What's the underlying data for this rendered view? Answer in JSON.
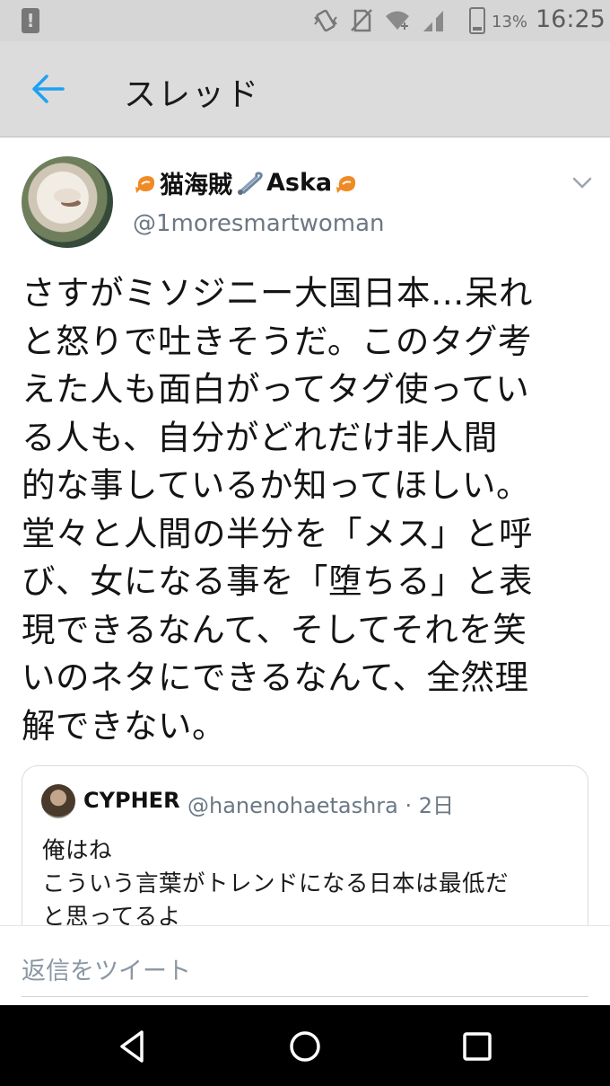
{
  "status_bar": {
    "battery_percent": "13%",
    "time": "16:25",
    "alert_symbol": "!"
  },
  "app_bar": {
    "title": "スレッド",
    "back_icon": "arrow-left-icon"
  },
  "tweet": {
    "display_name": "猫海賊",
    "display_name_suffix": "Aska",
    "handle": "@1moresmartwoman",
    "text": "さすがミソジニー大国日本…呆れ\nと怒りで吐きそうだ。このタグ考\nえた人も面白がってタグ使ってい\nる人も、自分がどれだけ非人間\n的な事しているか知ってほしい。\n堂々と人間の半分を「メス」と呼\nび、女になる事を「堕ちる」と表\n現できるなんて、そしてそれを笑\nいのネタにできるなんて、全然理\n解できない。"
  },
  "quoted_tweet": {
    "name": "CYPHER",
    "handle_and_time": "@hanenohaetashra · 2日",
    "text": "俺はね\nこういう言葉がトレンドになる日本は最低だ\nと思ってるよ"
  },
  "reply": {
    "placeholder": "返信をツイート"
  },
  "colors": {
    "accent": "#1da1f2",
    "header_bg": "#dcdcdc",
    "status_bg": "#d6d6d6",
    "secondary_text": "#6b7884"
  }
}
